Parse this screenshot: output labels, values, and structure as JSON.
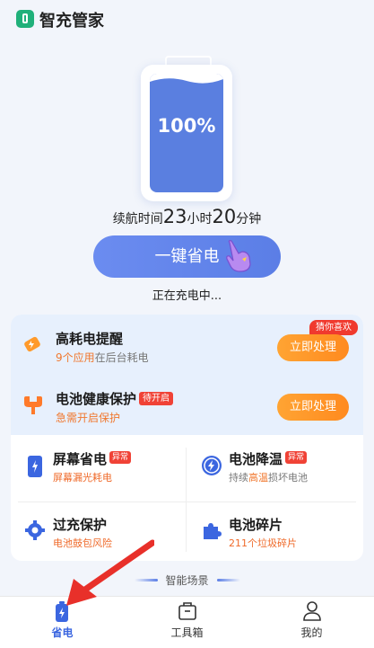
{
  "app": {
    "title": "智充管家"
  },
  "battery": {
    "percent": "100%",
    "level": 1.0,
    "endurance_prefix": "续航时间",
    "hours": "23",
    "hours_unit": "小时",
    "minutes": "20",
    "minutes_unit": "分钟",
    "one_key_label": "一键省电",
    "status": "正在充电中..."
  },
  "alerts": {
    "guess_tag": "猜你喜欢",
    "rows": [
      {
        "title": "高耗电提醒",
        "sub_highlight": "9个应用",
        "sub_rest": "在后台耗电",
        "button": "立即处理",
        "icon": "battery-drain-icon"
      },
      {
        "title": "电池健康保护",
        "tag": "待开启",
        "sub_highlight": "急需开启保护",
        "button": "立即处理",
        "icon": "wrench-icon"
      }
    ]
  },
  "grid": [
    {
      "title": "屏幕省电",
      "tag": "异常",
      "sub": "屏幕漏光耗电",
      "icon": "phone-icon"
    },
    {
      "title": "电池降温",
      "tag": "异常",
      "sub_prefix": "持续",
      "sub_highlight": "高温",
      "sub_suffix": "损坏电池",
      "icon": "bolt-circle-icon"
    },
    {
      "title": "过充保护",
      "sub": "电池鼓包风险",
      "icon": "gear-icon"
    },
    {
      "title": "电池碎片",
      "sub": "211个垃圾碎片",
      "icon": "puzzle-icon"
    }
  ],
  "scene": {
    "label": "智能场景"
  },
  "nav": [
    {
      "label": "省电",
      "icon": "battery-bolt-icon",
      "active": true
    },
    {
      "label": "工具箱",
      "icon": "toolbox-icon",
      "active": false
    },
    {
      "label": "我的",
      "icon": "person-icon",
      "active": false
    }
  ],
  "colors": {
    "accent": "#5b7ee6",
    "orange": "#ff8a1f",
    "alert": "#f04236"
  }
}
